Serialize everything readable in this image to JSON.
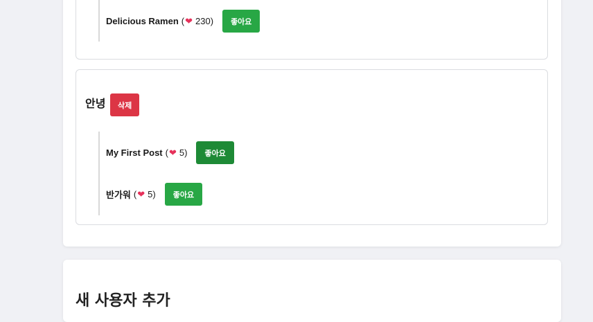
{
  "users": [
    {
      "name": "",
      "delete_label": "",
      "posts": [
        {
          "title": "Delicious Ramen",
          "open_paren": "(",
          "heart": "❤",
          "likes": "230",
          "close_paren": ")",
          "like_label": "좋아요"
        }
      ]
    },
    {
      "name": "안녕",
      "delete_label": "삭제",
      "posts": [
        {
          "title": "My First Post",
          "open_paren": "(",
          "heart": "❤",
          "likes": "5",
          "close_paren": ")",
          "like_label": "좋아요"
        },
        {
          "title": "반가워",
          "open_paren": "(",
          "heart": "❤",
          "likes": "5",
          "close_paren": ")",
          "like_label": "좋아요"
        }
      ]
    }
  ],
  "add_user": {
    "title": "새 사용자 추가"
  },
  "colors": {
    "like": "#28a745",
    "like_hover": "#1e8a36",
    "delete": "#dc3545",
    "heart": "#e6315a"
  }
}
